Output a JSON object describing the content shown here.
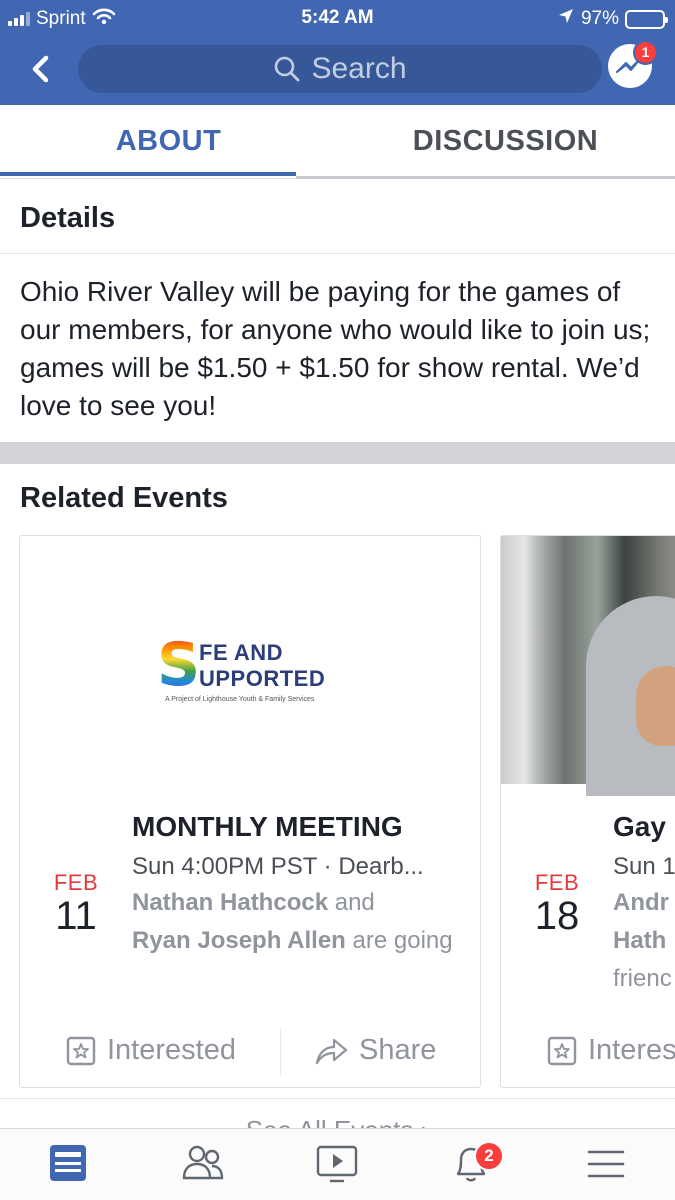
{
  "status_bar": {
    "carrier": "Sprint",
    "time": "5:42 AM",
    "battery": "97%"
  },
  "header": {
    "search_placeholder": "Search",
    "messenger_badge": "1"
  },
  "tabs": [
    {
      "label": "ABOUT",
      "active": true
    },
    {
      "label": "DISCUSSION",
      "active": false
    }
  ],
  "details": {
    "heading": "Details",
    "text": "Ohio River Valley will be paying for the games of our members, for anyone who would like to join us; games will be $1.50 + $1.50 for show rental. We’d love to see you!"
  },
  "related": {
    "heading": "Related Events",
    "events": [
      {
        "month": "FEB",
        "day": "11",
        "title": "MONTHLY MEETING",
        "time": "Sun 4:00PM PST · Dearb...",
        "going_name1": "Nathan Hathcock",
        "going_and": " and",
        "going_name2": "Ryan Joseph Allen",
        "going_suffix": " are going",
        "logo": {
          "line1": "FE AND",
          "line2": "UPPORTED",
          "tagline": "A Project of Lighthouse Youth & Family Services"
        },
        "interested_label": "Interested",
        "share_label": "Share"
      },
      {
        "month": "FEB",
        "day": "18",
        "title": "Gay",
        "time": "Sun 1",
        "going_name1": "Andr",
        "going_name2": "Hath",
        "going_suffix": "frienc",
        "interested_label": "Interes"
      }
    ],
    "see_all": "See All Events  ›"
  },
  "bottom_nav": {
    "notifications_badge": "2"
  },
  "colors": {
    "brand": "#4267b2",
    "search_bg": "#365899",
    "badge": "#fa3e3e",
    "date_month": "#e23a3a"
  }
}
